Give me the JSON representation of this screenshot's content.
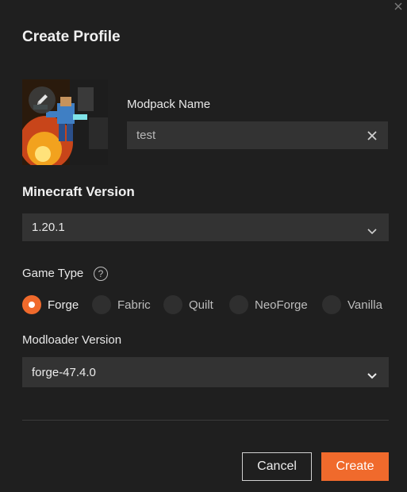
{
  "dialog": {
    "title": "Create Profile",
    "close_icon": "close-icon"
  },
  "modpack": {
    "label": "Modpack Name",
    "value": "test",
    "edit_icon": "pencil-icon",
    "clear_icon": "clear-icon"
  },
  "minecraft": {
    "label": "Minecraft Version",
    "value": "1.20.1",
    "dropdown_icon": "chevron-down-icon"
  },
  "game_type": {
    "label": "Game Type",
    "help_glyph": "?",
    "options": [
      "Forge",
      "Fabric",
      "Quilt",
      "NeoForge",
      "Vanilla"
    ],
    "selected": "Forge"
  },
  "modloader": {
    "label": "Modloader Version",
    "value": "forge-47.4.0",
    "dropdown_icon": "chevron-down-icon"
  },
  "actions": {
    "cancel_label": "Cancel",
    "create_label": "Create"
  },
  "colors": {
    "accent": "#f06a2c",
    "background": "#1f1f1f",
    "field": "#333333"
  }
}
